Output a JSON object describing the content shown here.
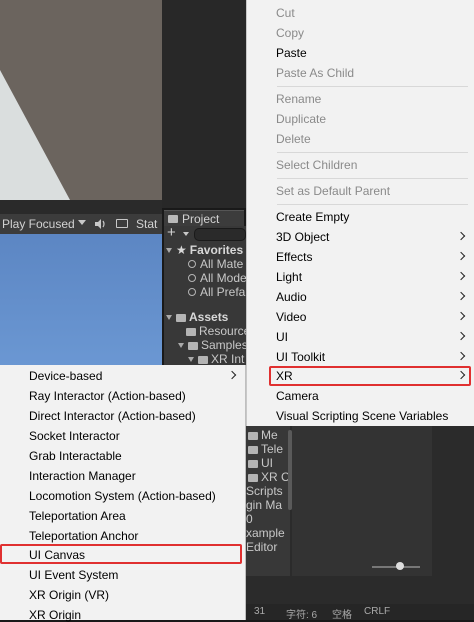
{
  "game_toolbar": {
    "play_focused": "Play Focused",
    "stats_label": "Stat"
  },
  "project": {
    "tab_label": "Project",
    "tree": {
      "favorites": "Favorites",
      "fav_items": [
        "All Mate",
        "All Mode",
        "All Prefa"
      ],
      "assets": "Assets",
      "asset_items": [
        "Resource",
        "Samples",
        "XR Int"
      ]
    }
  },
  "bottom_panel": {
    "folders": [
      "Me",
      "Tele",
      "UI",
      "XR C"
    ],
    "files": [
      "Scripts",
      "gin Ma",
      "0",
      "xample",
      "Editor"
    ],
    "status": [
      "31",
      "字符: 6",
      "空格",
      "CRLF"
    ]
  },
  "context_menu": {
    "cut": "Cut",
    "copy": "Copy",
    "paste": "Paste",
    "paste_as_child": "Paste As Child",
    "rename": "Rename",
    "duplicate": "Duplicate",
    "delete": "Delete",
    "select_children": "Select Children",
    "set_default_parent": "Set as Default Parent",
    "create_empty": "Create Empty",
    "object_3d": "3D Object",
    "effects": "Effects",
    "light": "Light",
    "audio": "Audio",
    "video": "Video",
    "ui": "UI",
    "ui_toolkit": "UI Toolkit",
    "xr": "XR",
    "camera": "Camera",
    "visual_scripting": "Visual Scripting Scene Variables"
  },
  "xr_submenu": {
    "items": [
      "Device-based",
      "Ray Interactor (Action-based)",
      "Direct Interactor (Action-based)",
      "Socket Interactor",
      "Grab Interactable",
      "Interaction Manager",
      "Locomotion System (Action-based)",
      "Teleportation Area",
      "Teleportation Anchor",
      "UI Canvas",
      "UI Event System",
      "XR Origin (VR)",
      "XR Origin"
    ]
  },
  "colors": {
    "highlight": "#e03030",
    "menu_bg": "#f2f2f2",
    "disabled_text": "#8a8a8a"
  }
}
